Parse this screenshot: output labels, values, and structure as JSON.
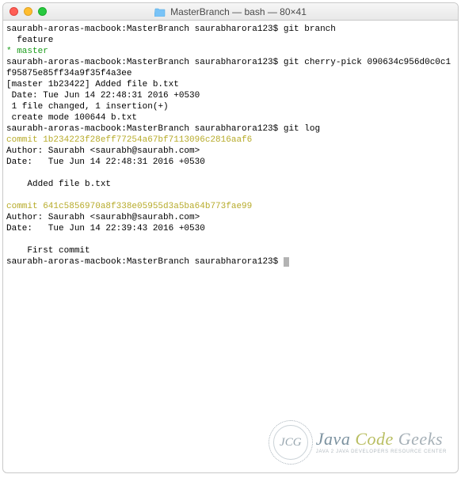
{
  "titlebar": {
    "title": "MasterBranch — bash — 80×41"
  },
  "terminal": {
    "line1_prompt": "saurabh-aroras-macbook:MasterBranch saurabharora123$ ",
    "line1_cmd": "git branch",
    "line2": "  feature",
    "line3_star": "* ",
    "line3_branch": "master",
    "line4_prompt": "saurabh-aroras-macbook:MasterBranch saurabharora123$ ",
    "line4_cmd": "git cherry-pick 090634c956d0c0c1f95875e85ff34a9f35f4a3ee",
    "line6": "[master 1b23422] Added file b.txt",
    "line7": " Date: Tue Jun 14 22:48:31 2016 +0530",
    "line8": " 1 file changed, 1 insertion(+)",
    "line9": " create mode 100644 b.txt",
    "line10_prompt": "saurabh-aroras-macbook:MasterBranch saurabharora123$ ",
    "line10_cmd": "git log",
    "commit1_hash": "commit 1b234223f28eff77254a67bf7113096c2816aaf6",
    "commit1_author": "Author: Saurabh <saurabh@saurabh.com>",
    "commit1_date": "Date:   Tue Jun 14 22:48:31 2016 +0530",
    "commit1_msg": "    Added file b.txt",
    "commit2_hash": "commit 641c5856970a8f338e05955d3a5ba64b773fae99",
    "commit2_author": "Author: Saurabh <saurabh@saurabh.com>",
    "commit2_date": "Date:   Tue Jun 14 22:39:43 2016 +0530",
    "commit2_msg": "    First commit",
    "final_prompt": "saurabh-aroras-macbook:MasterBranch saurabharora123$ "
  },
  "watermark": {
    "logo_text": "JCG",
    "word_a": "Java",
    "word_b": "Code",
    "word_c": "Geeks",
    "tagline": "JAVA 2 JAVA DEVELOPERS RESOURCE CENTER"
  }
}
